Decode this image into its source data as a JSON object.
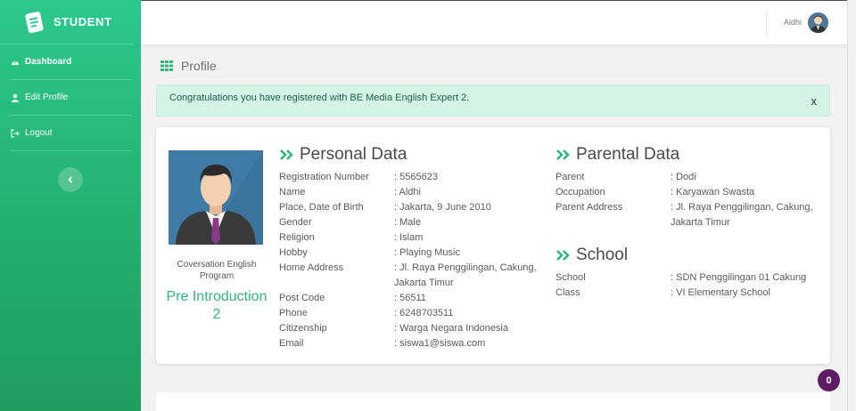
{
  "brand": {
    "name": "STUDENT"
  },
  "sidebar": {
    "items": [
      {
        "label": "Dashboard",
        "icon": "dashboard-icon"
      },
      {
        "label": "Edit Profile",
        "icon": "user-icon"
      },
      {
        "label": "Logout",
        "icon": "logout-icon"
      }
    ],
    "toggle_icon": "chevron-left-icon"
  },
  "topbar": {
    "user_name": "Aldhi"
  },
  "page": {
    "title": "Profile",
    "title_icon": "grid-icon"
  },
  "alert": {
    "message": "Congratulations you have registered with BE Media English Expert 2.",
    "close": "x"
  },
  "profile": {
    "program_label": "Coversation English Program",
    "program_value": "Pre Introduction 2"
  },
  "personal": {
    "title": "Personal Data",
    "rows": [
      {
        "label": "Registration Number",
        "value": ": 5565623"
      },
      {
        "label": "Name",
        "value": ": Aldhi"
      },
      {
        "label": "Place, Date of Birth",
        "value": ": Jakarta, 9 June 2010"
      },
      {
        "label": "Gender",
        "value": ": Male"
      },
      {
        "label": "Religion",
        "value": ": Islam"
      },
      {
        "label": "Hobby",
        "value": ": Playing Music"
      },
      {
        "label": "Home Address",
        "value": ": Jl. Raya Penggilingan, Cakung,",
        "value2": "Jakarta Timur"
      },
      {
        "label": "Post Code",
        "value": ": 56511"
      },
      {
        "label": "Phone",
        "value": ": 6248703511"
      },
      {
        "label": "Citizenship",
        "value": ": Warga Negara Indonesia"
      },
      {
        "label": "Email",
        "value": ": siswa1@siswa.com"
      }
    ]
  },
  "parental": {
    "title": "Parental Data",
    "rows": [
      {
        "label": "Parent",
        "value": ": Dodi"
      },
      {
        "label": "Occupation",
        "value": ": Karyawan Swasta"
      },
      {
        "label": "Parent Address",
        "value": ": Jl. Raya Penggilingan, Cakung,",
        "value2": "Jakarta Timur"
      }
    ]
  },
  "school": {
    "title": "School",
    "rows": [
      {
        "label": "School",
        "value": ": SDN Penggilingan 01 Cakung"
      },
      {
        "label": "Class",
        "value": ": VI Elementary School"
      }
    ]
  },
  "notification": {
    "count": "0"
  },
  "colors": {
    "accent": "#2cc88d",
    "badge": "#5e1d62"
  }
}
